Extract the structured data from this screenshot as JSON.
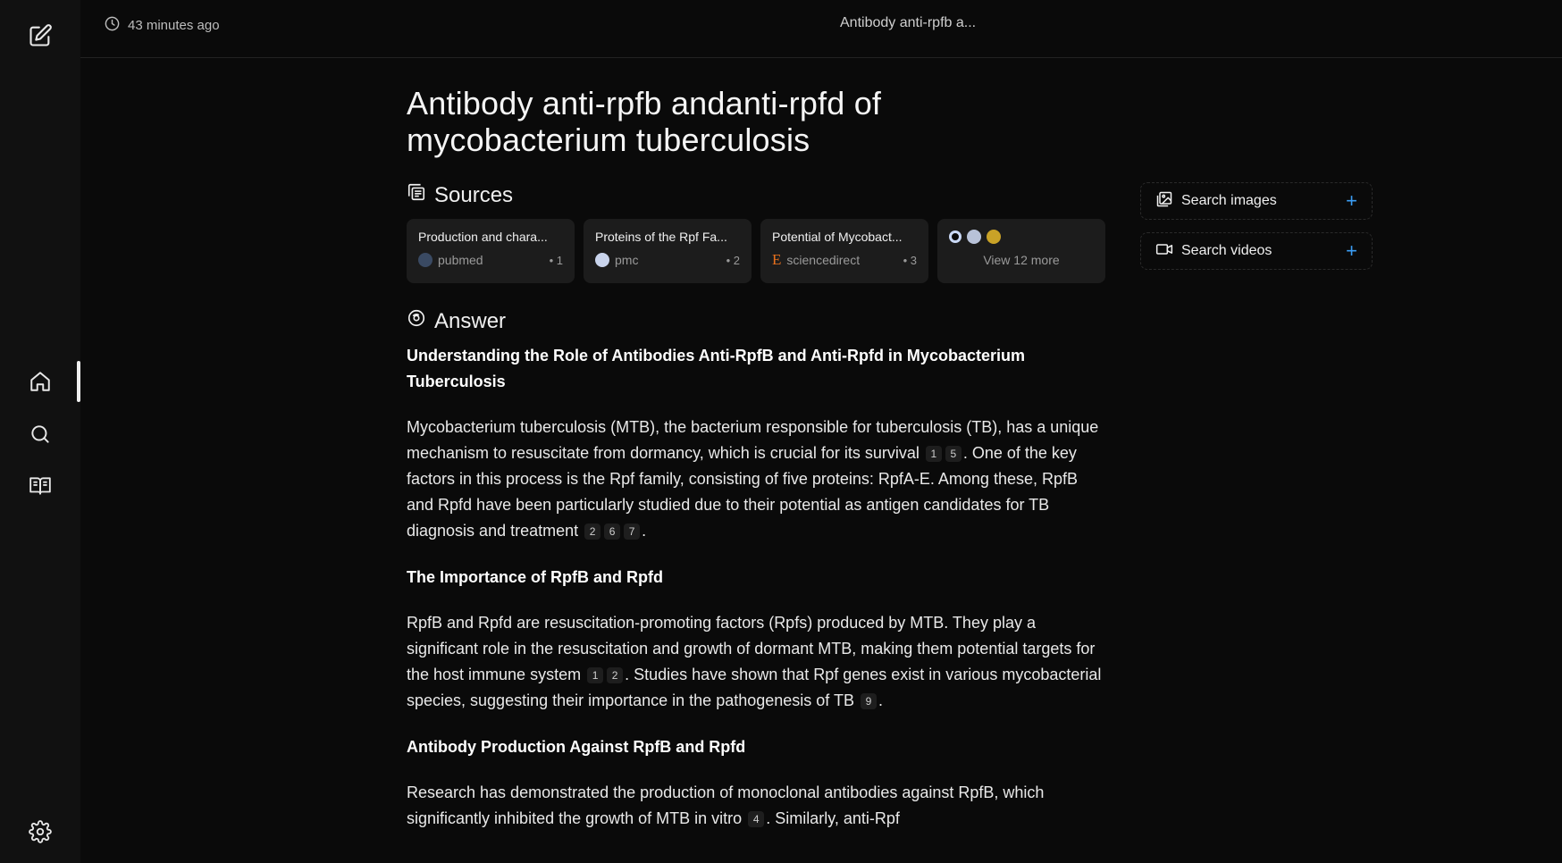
{
  "sidebar": {
    "icons": [
      "new-thread-icon",
      "home-icon",
      "search-icon",
      "library-icon",
      "settings-icon"
    ]
  },
  "topbar": {
    "time": "43 minutes ago",
    "title": "Antibody anti-rpfb a..."
  },
  "page": {
    "title": "Antibody anti-rpfb andanti-rpfd of mycobacterium tuberculosis"
  },
  "sources": {
    "heading": "Sources",
    "cards": [
      {
        "title": "Production and chara...",
        "site": "pubmed",
        "num": "• 1"
      },
      {
        "title": "Proteins of the Rpf Fa...",
        "site": "pmc",
        "num": "• 2"
      },
      {
        "title": "Potential of Mycobact...",
        "site": "sciencedirect",
        "num": "• 3"
      }
    ],
    "more_label": "View 12 more"
  },
  "answer": {
    "heading": "Answer",
    "h1": "Understanding the Role of Antibodies Anti-RpfB and Anti-Rpfd in Mycobacterium Tuberculosis",
    "p1a": "Mycobacterium tuberculosis (MTB), the bacterium responsible for tuberculosis (TB), has a unique mechanism to resuscitate from dormancy, which is crucial for its survival",
    "p1b": ". One of the key factors in this process is the Rpf family, consisting of five proteins: RpfA-E. Among these, RpfB and Rpfd have been particularly studied due to their potential as antigen candidates for TB diagnosis and treatment",
    "p1c": ".",
    "h2": "The Importance of RpfB and Rpfd",
    "p2a": "RpfB and Rpfd are resuscitation-promoting factors (Rpfs) produced by MTB. They play a significant role in the resuscitation and growth of dormant MTB, making them potential targets for the host immune system",
    "p2b": ". Studies have shown that Rpf genes exist in various mycobacterial species, suggesting their importance in the pathogenesis of TB",
    "p2c": ".",
    "h3": "Antibody Production Against RpfB and Rpfd",
    "p3a": "Research has demonstrated the production of monoclonal antibodies against RpfB, which significantly inhibited the growth of MTB in vitro",
    "p3b": ". Similarly, anti-Rpf",
    "cites": {
      "c1": "1",
      "c5": "5",
      "c2": "2",
      "c6": "6",
      "c7": "7",
      "c9": "9",
      "c4": "4"
    }
  },
  "right_panel": {
    "search_images": "Search images",
    "search_videos": "Search videos",
    "plus": "+"
  },
  "colors": {
    "accent": "#3b9ef5",
    "background": "#0a0a0a",
    "card": "#1c1c1c"
  }
}
